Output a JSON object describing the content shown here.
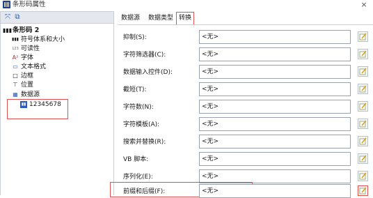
{
  "window": {
    "title": "条形码属性",
    "close": "×"
  },
  "left_toolbar": {
    "btn1": "⤧",
    "btn2": "⧉"
  },
  "tree": {
    "root": "条形码 2",
    "items": [
      {
        "icon": "▮▮▮",
        "label": "符号体系和大小"
      },
      {
        "icon": "123",
        "label": "可读性"
      },
      {
        "icon": "A²",
        "label": "字体"
      },
      {
        "icon": "▭",
        "label": "文本格式"
      },
      {
        "icon": "□",
        "label": "边框"
      },
      {
        "icon": "⊤",
        "label": "位置"
      },
      {
        "icon": "▦",
        "label": "数据源"
      }
    ],
    "leaf": "12345678"
  },
  "tabs": [
    "数据源",
    "数据类型",
    "转换"
  ],
  "rows": [
    {
      "label": "抑制(S):",
      "value": "<无>"
    },
    {
      "label": "字符筛选器(C):",
      "value": "<无>"
    },
    {
      "label": "数据输入控件(D):",
      "value": "<无>"
    },
    {
      "label": "截短(T):",
      "value": "<无>"
    },
    {
      "label": "字符数(N):",
      "value": "<无>"
    },
    {
      "label": "字符模板(A):",
      "value": "<无>"
    },
    {
      "label": "搜索并替换(R):",
      "value": "<无>"
    },
    {
      "label": "VB 脚本:",
      "value": "<无>"
    },
    {
      "label": "序列化(E):",
      "value": "<无>"
    },
    {
      "label": "前缀和后缀(F):",
      "value": "<无>"
    }
  ],
  "colors": {
    "highlight": "#e05050",
    "accent": "#2b5cb8"
  }
}
